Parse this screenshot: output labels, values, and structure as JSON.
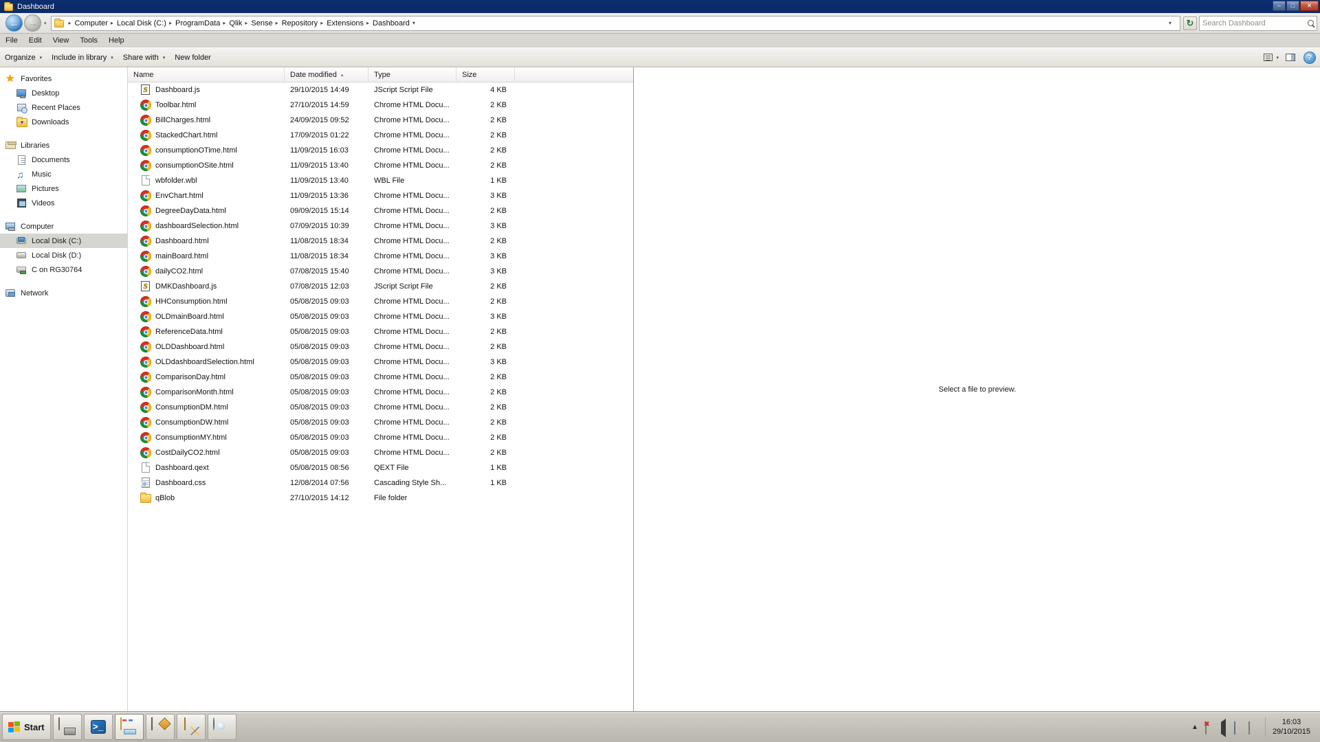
{
  "window": {
    "title": "Dashboard",
    "title_icon": "folder-icon",
    "controls": {
      "minimize": "–",
      "maximize": "□",
      "close": "✕"
    }
  },
  "address_bar": {
    "back_glyph": "←",
    "forward_glyph": "→",
    "history_caret": "▾",
    "crumbs": [
      "Computer",
      "Local Disk (C:)",
      "ProgramData",
      "Qlik",
      "Sense",
      "Repository",
      "Extensions",
      "Dashboard"
    ],
    "separator": "▸",
    "trailing_caret": "▾",
    "dropdown_caret": "▾",
    "refresh_icon": "refresh-icon",
    "refresh_glyph": "↻"
  },
  "search": {
    "value": "Search Dashboard",
    "placeholder": "Search Dashboard",
    "icon": "search-icon"
  },
  "menu": {
    "items": [
      "File",
      "Edit",
      "View",
      "Tools",
      "Help"
    ]
  },
  "command_bar": {
    "items": [
      {
        "label": "Organize",
        "has_caret": true
      },
      {
        "label": "Include in library",
        "has_caret": true
      },
      {
        "label": "Share with",
        "has_caret": true
      },
      {
        "label": "New folder",
        "has_caret": false
      }
    ],
    "caret": "▾",
    "view_icon": "view-list-icon",
    "view_caret": "▾",
    "preview_pane_icon": "preview-pane-icon",
    "help_label": "?"
  },
  "nav_pane": {
    "groups": [
      {
        "header": {
          "label": "Favorites",
          "icon": "star-icon"
        },
        "items": [
          {
            "label": "Desktop",
            "icon": "desktop-icon"
          },
          {
            "label": "Recent Places",
            "icon": "recent-places-icon"
          },
          {
            "label": "Downloads",
            "icon": "downloads-folder-icon"
          }
        ]
      },
      {
        "header": {
          "label": "Libraries",
          "icon": "libraries-icon"
        },
        "items": [
          {
            "label": "Documents",
            "icon": "documents-icon"
          },
          {
            "label": "Music",
            "icon": "music-icon"
          },
          {
            "label": "Pictures",
            "icon": "pictures-icon"
          },
          {
            "label": "Videos",
            "icon": "videos-icon"
          }
        ]
      },
      {
        "header": {
          "label": "Computer",
          "icon": "computer-icon"
        },
        "items": [
          {
            "label": "Local Disk (C:)",
            "icon": "system-drive-icon",
            "selected": true
          },
          {
            "label": "Local Disk (D:)",
            "icon": "drive-icon"
          },
          {
            "label": "C on RG30764",
            "icon": "network-drive-icon"
          }
        ]
      },
      {
        "header": {
          "label": "Network",
          "icon": "network-icon"
        },
        "items": []
      }
    ]
  },
  "file_list": {
    "columns": [
      {
        "label": "Name",
        "sorted": false
      },
      {
        "label": "Date modified",
        "sorted": true,
        "sort_glyph": "▴"
      },
      {
        "label": "Type",
        "sorted": false
      },
      {
        "label": "Size",
        "sorted": false
      }
    ],
    "rows": [
      {
        "name": "Dashboard.js",
        "date": "29/10/2015 14:49",
        "type": "JScript Script File",
        "size": "4 KB",
        "icon": "jscript-file-icon"
      },
      {
        "name": "Toolbar.html",
        "date": "27/10/2015 14:59",
        "type": "Chrome HTML Docu...",
        "size": "2 KB",
        "icon": "chrome-html-icon"
      },
      {
        "name": "BillCharges.html",
        "date": "24/09/2015 09:52",
        "type": "Chrome HTML Docu...",
        "size": "2 KB",
        "icon": "chrome-html-icon"
      },
      {
        "name": "StackedChart.html",
        "date": "17/09/2015 01:22",
        "type": "Chrome HTML Docu...",
        "size": "2 KB",
        "icon": "chrome-html-icon"
      },
      {
        "name": "consumptionOTime.html",
        "date": "11/09/2015 16:03",
        "type": "Chrome HTML Docu...",
        "size": "2 KB",
        "icon": "chrome-html-icon"
      },
      {
        "name": "consumptionOSite.html",
        "date": "11/09/2015 13:40",
        "type": "Chrome HTML Docu...",
        "size": "2 KB",
        "icon": "chrome-html-icon"
      },
      {
        "name": "wbfolder.wbl",
        "date": "11/09/2015 13:40",
        "type": "WBL File",
        "size": "1 KB",
        "icon": "generic-file-icon"
      },
      {
        "name": "EnvChart.html",
        "date": "11/09/2015 13:36",
        "type": "Chrome HTML Docu...",
        "size": "3 KB",
        "icon": "chrome-html-icon"
      },
      {
        "name": "DegreeDayData.html",
        "date": "09/09/2015 15:14",
        "type": "Chrome HTML Docu...",
        "size": "2 KB",
        "icon": "chrome-html-icon"
      },
      {
        "name": "dashboardSelection.html",
        "date": "07/09/2015 10:39",
        "type": "Chrome HTML Docu...",
        "size": "3 KB",
        "icon": "chrome-html-icon"
      },
      {
        "name": "Dashboard.html",
        "date": "11/08/2015 18:34",
        "type": "Chrome HTML Docu...",
        "size": "2 KB",
        "icon": "chrome-html-icon"
      },
      {
        "name": "mainBoard.html",
        "date": "11/08/2015 18:34",
        "type": "Chrome HTML Docu...",
        "size": "3 KB",
        "icon": "chrome-html-icon"
      },
      {
        "name": "dailyCO2.html",
        "date": "07/08/2015 15:40",
        "type": "Chrome HTML Docu...",
        "size": "3 KB",
        "icon": "chrome-html-icon"
      },
      {
        "name": "DMKDashboard.js",
        "date": "07/08/2015 12:03",
        "type": "JScript Script File",
        "size": "2 KB",
        "icon": "jscript-file-icon"
      },
      {
        "name": "HHConsumption.html",
        "date": "05/08/2015 09:03",
        "type": "Chrome HTML Docu...",
        "size": "2 KB",
        "icon": "chrome-html-icon"
      },
      {
        "name": "OLDmainBoard.html",
        "date": "05/08/2015 09:03",
        "type": "Chrome HTML Docu...",
        "size": "3 KB",
        "icon": "chrome-html-icon"
      },
      {
        "name": "ReferenceData.html",
        "date": "05/08/2015 09:03",
        "type": "Chrome HTML Docu...",
        "size": "2 KB",
        "icon": "chrome-html-icon"
      },
      {
        "name": "OLDDashboard.html",
        "date": "05/08/2015 09:03",
        "type": "Chrome HTML Docu...",
        "size": "2 KB",
        "icon": "chrome-html-icon"
      },
      {
        "name": "OLDdashboardSelection.html",
        "date": "05/08/2015 09:03",
        "type": "Chrome HTML Docu...",
        "size": "3 KB",
        "icon": "chrome-html-icon"
      },
      {
        "name": "ComparisonDay.html",
        "date": "05/08/2015 09:03",
        "type": "Chrome HTML Docu...",
        "size": "2 KB",
        "icon": "chrome-html-icon"
      },
      {
        "name": "ComparisonMonth.html",
        "date": "05/08/2015 09:03",
        "type": "Chrome HTML Docu...",
        "size": "2 KB",
        "icon": "chrome-html-icon"
      },
      {
        "name": "ConsumptionDM.html",
        "date": "05/08/2015 09:03",
        "type": "Chrome HTML Docu...",
        "size": "2 KB",
        "icon": "chrome-html-icon"
      },
      {
        "name": "ConsumptionDW.html",
        "date": "05/08/2015 09:03",
        "type": "Chrome HTML Docu...",
        "size": "2 KB",
        "icon": "chrome-html-icon"
      },
      {
        "name": "ConsumptionMY.html",
        "date": "05/08/2015 09:03",
        "type": "Chrome HTML Docu...",
        "size": "2 KB",
        "icon": "chrome-html-icon"
      },
      {
        "name": "CostDailyCO2.html",
        "date": "05/08/2015 09:03",
        "type": "Chrome HTML Docu...",
        "size": "2 KB",
        "icon": "chrome-html-icon"
      },
      {
        "name": "Dashboard.qext",
        "date": "05/08/2015 08:56",
        "type": "QEXT File",
        "size": "1 KB",
        "icon": "generic-file-icon"
      },
      {
        "name": "Dashboard.css",
        "date": "12/08/2014 07:56",
        "type": "Cascading Style Sh...",
        "size": "1 KB",
        "icon": "css-file-icon"
      },
      {
        "name": "qBlob",
        "date": "27/10/2015 14:12",
        "type": "File folder",
        "size": "",
        "icon": "folder-icon"
      }
    ]
  },
  "preview_pane": {
    "message": "Select a file to preview."
  },
  "taskbar": {
    "start_label": "Start",
    "buttons": [
      {
        "name": "server-manager",
        "icon": "server-manager-icon",
        "active": false
      },
      {
        "name": "powershell",
        "icon": "powershell-icon",
        "active": false
      },
      {
        "name": "windows-explorer",
        "icon": "explorer-folder-icon",
        "active": true
      },
      {
        "name": "notepad-plus-plus",
        "icon": "notepad-plus-plus-icon",
        "active": false
      },
      {
        "name": "database-tool",
        "icon": "database-tool-icon",
        "active": false
      },
      {
        "name": "shell-app",
        "icon": "shell-icon",
        "active": false
      }
    ],
    "tray": {
      "chevron": "▲",
      "icons": [
        "action-center-icon",
        "volume-icon",
        "network-icon",
        "flag-icon"
      ]
    },
    "clock": {
      "time": "16:03",
      "date": "29/10/2015"
    }
  }
}
